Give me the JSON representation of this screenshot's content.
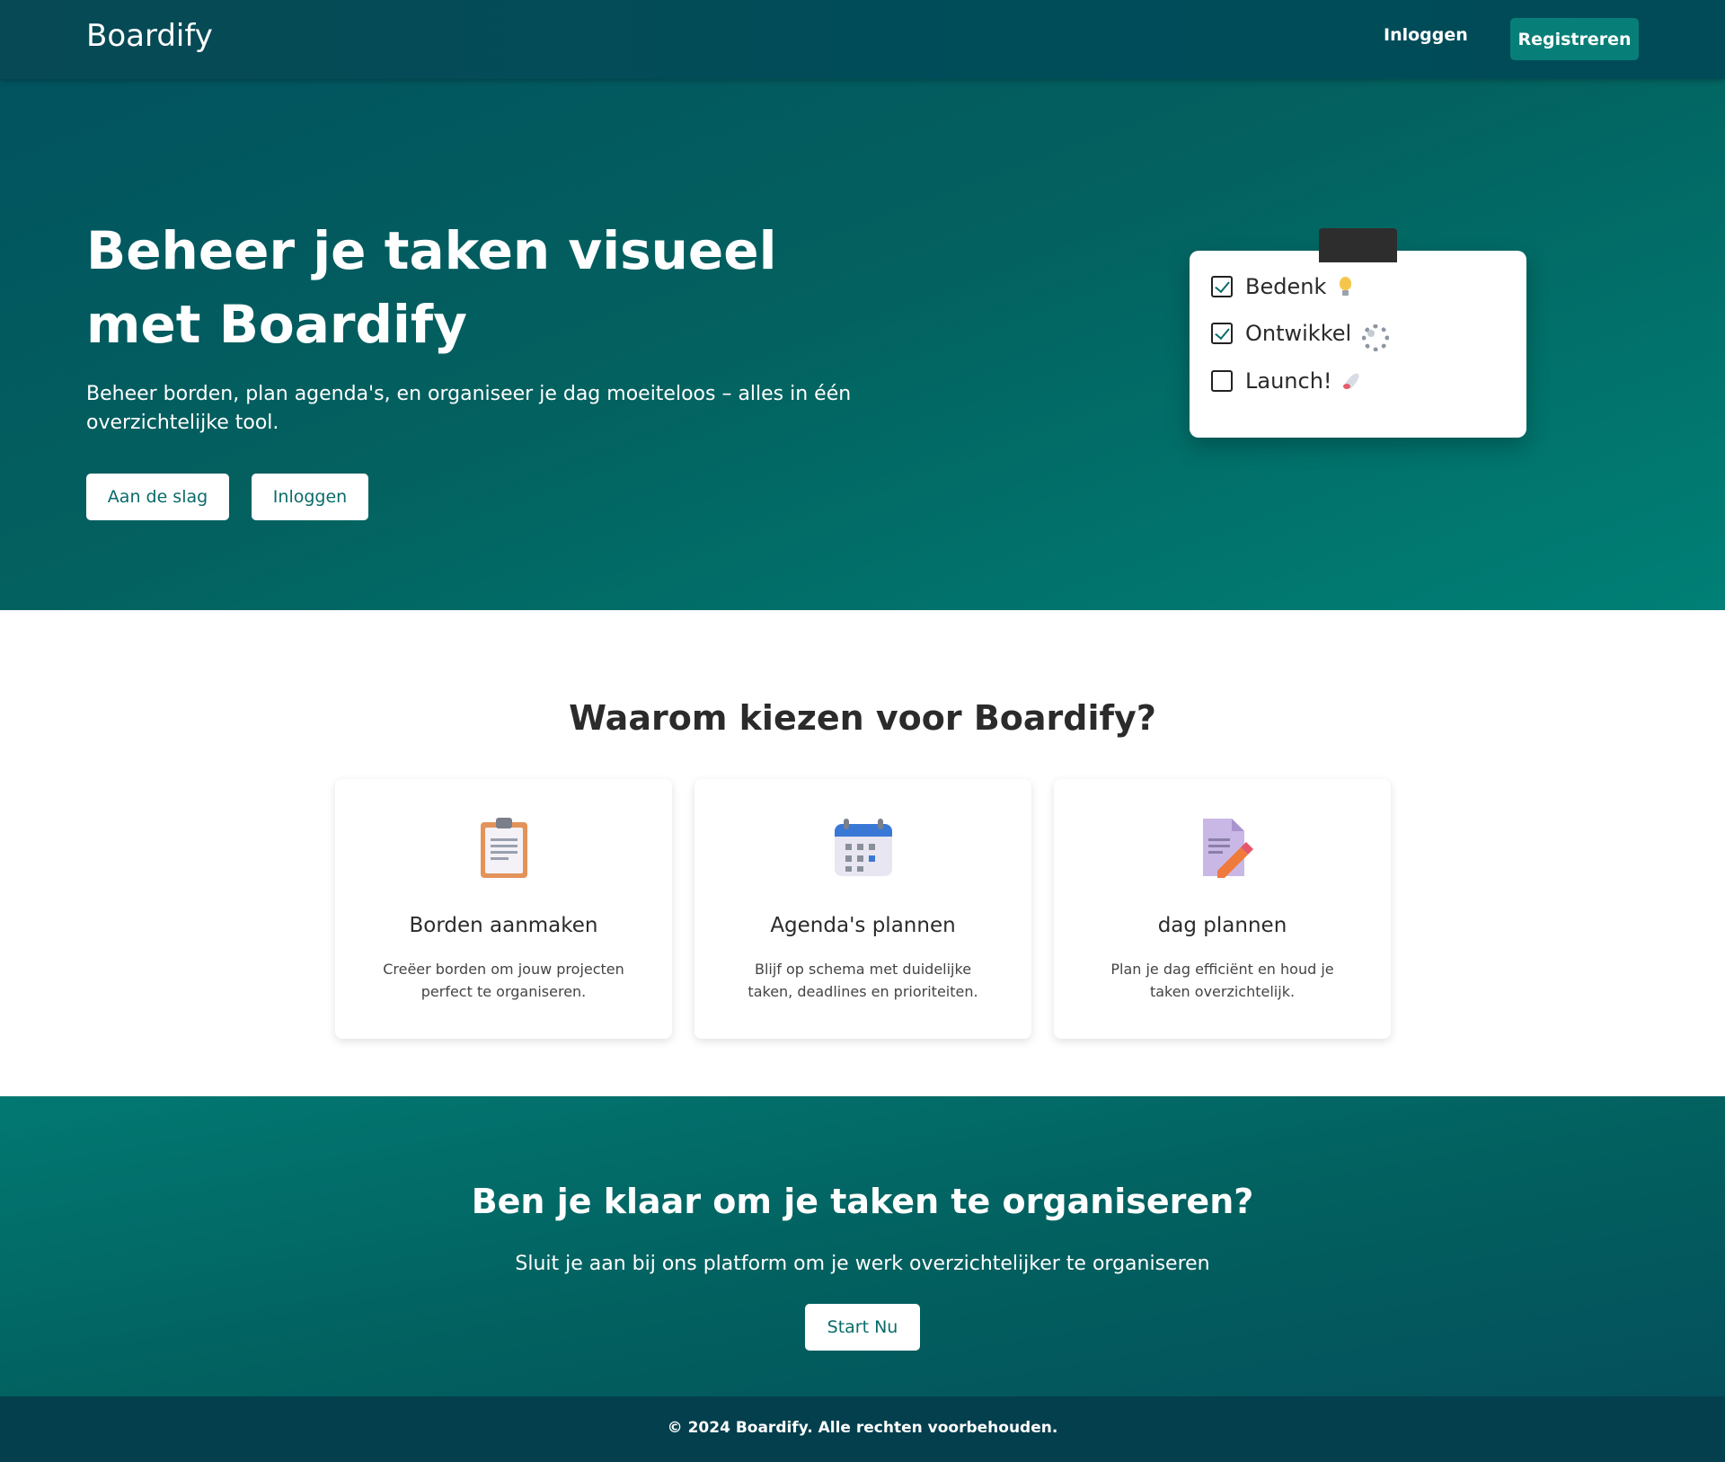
{
  "navbar": {
    "brand": "Boardify",
    "login_label": "Inloggen",
    "register_label": "Registreren"
  },
  "hero": {
    "title": "Beheer je taken visueel met Boardify",
    "subtitle": "Beheer borden, plan agenda's, en organiseer je dag moeiteloos – alles in één overzichtelijke tool.",
    "primary_button": "Aan de slag",
    "secondary_button": "Inloggen",
    "checklist": [
      {
        "label": "Bedenk",
        "checked": true,
        "icon": "lightbulb-icon"
      },
      {
        "label": "Ontwikkel",
        "checked": true,
        "icon": "gear-icon"
      },
      {
        "label": "Launch!",
        "checked": false,
        "icon": "rocket-icon"
      }
    ]
  },
  "features": {
    "title": "Waarom kiezen voor Boardify?",
    "items": [
      {
        "icon": "clipboard-icon",
        "title": "Borden aanmaken",
        "description": "Creëer borden om jouw projecten perfect te organiseren."
      },
      {
        "icon": "calendar-icon",
        "title": "Agenda's plannen",
        "description": "Blijf op schema met duidelijke taken, deadlines en prioriteiten."
      },
      {
        "icon": "document-pencil-icon",
        "title": "dag plannen",
        "description": "Plan je dag efficiënt en houd je taken overzichtelijk."
      }
    ]
  },
  "cta": {
    "title": "Ben je klaar om je taken te organiseren?",
    "subtitle": "Sluit je aan bij ons platform om je werk overzichtelijker te organiseren",
    "button": "Start Nu"
  },
  "footer": {
    "text": "© 2024 Boardify. Alle rechten voorbehouden."
  },
  "colors": {
    "primary": "#077f78",
    "navbar": "#004d5a",
    "footer": "#043f4d",
    "button_text": "#0a6b6a"
  }
}
